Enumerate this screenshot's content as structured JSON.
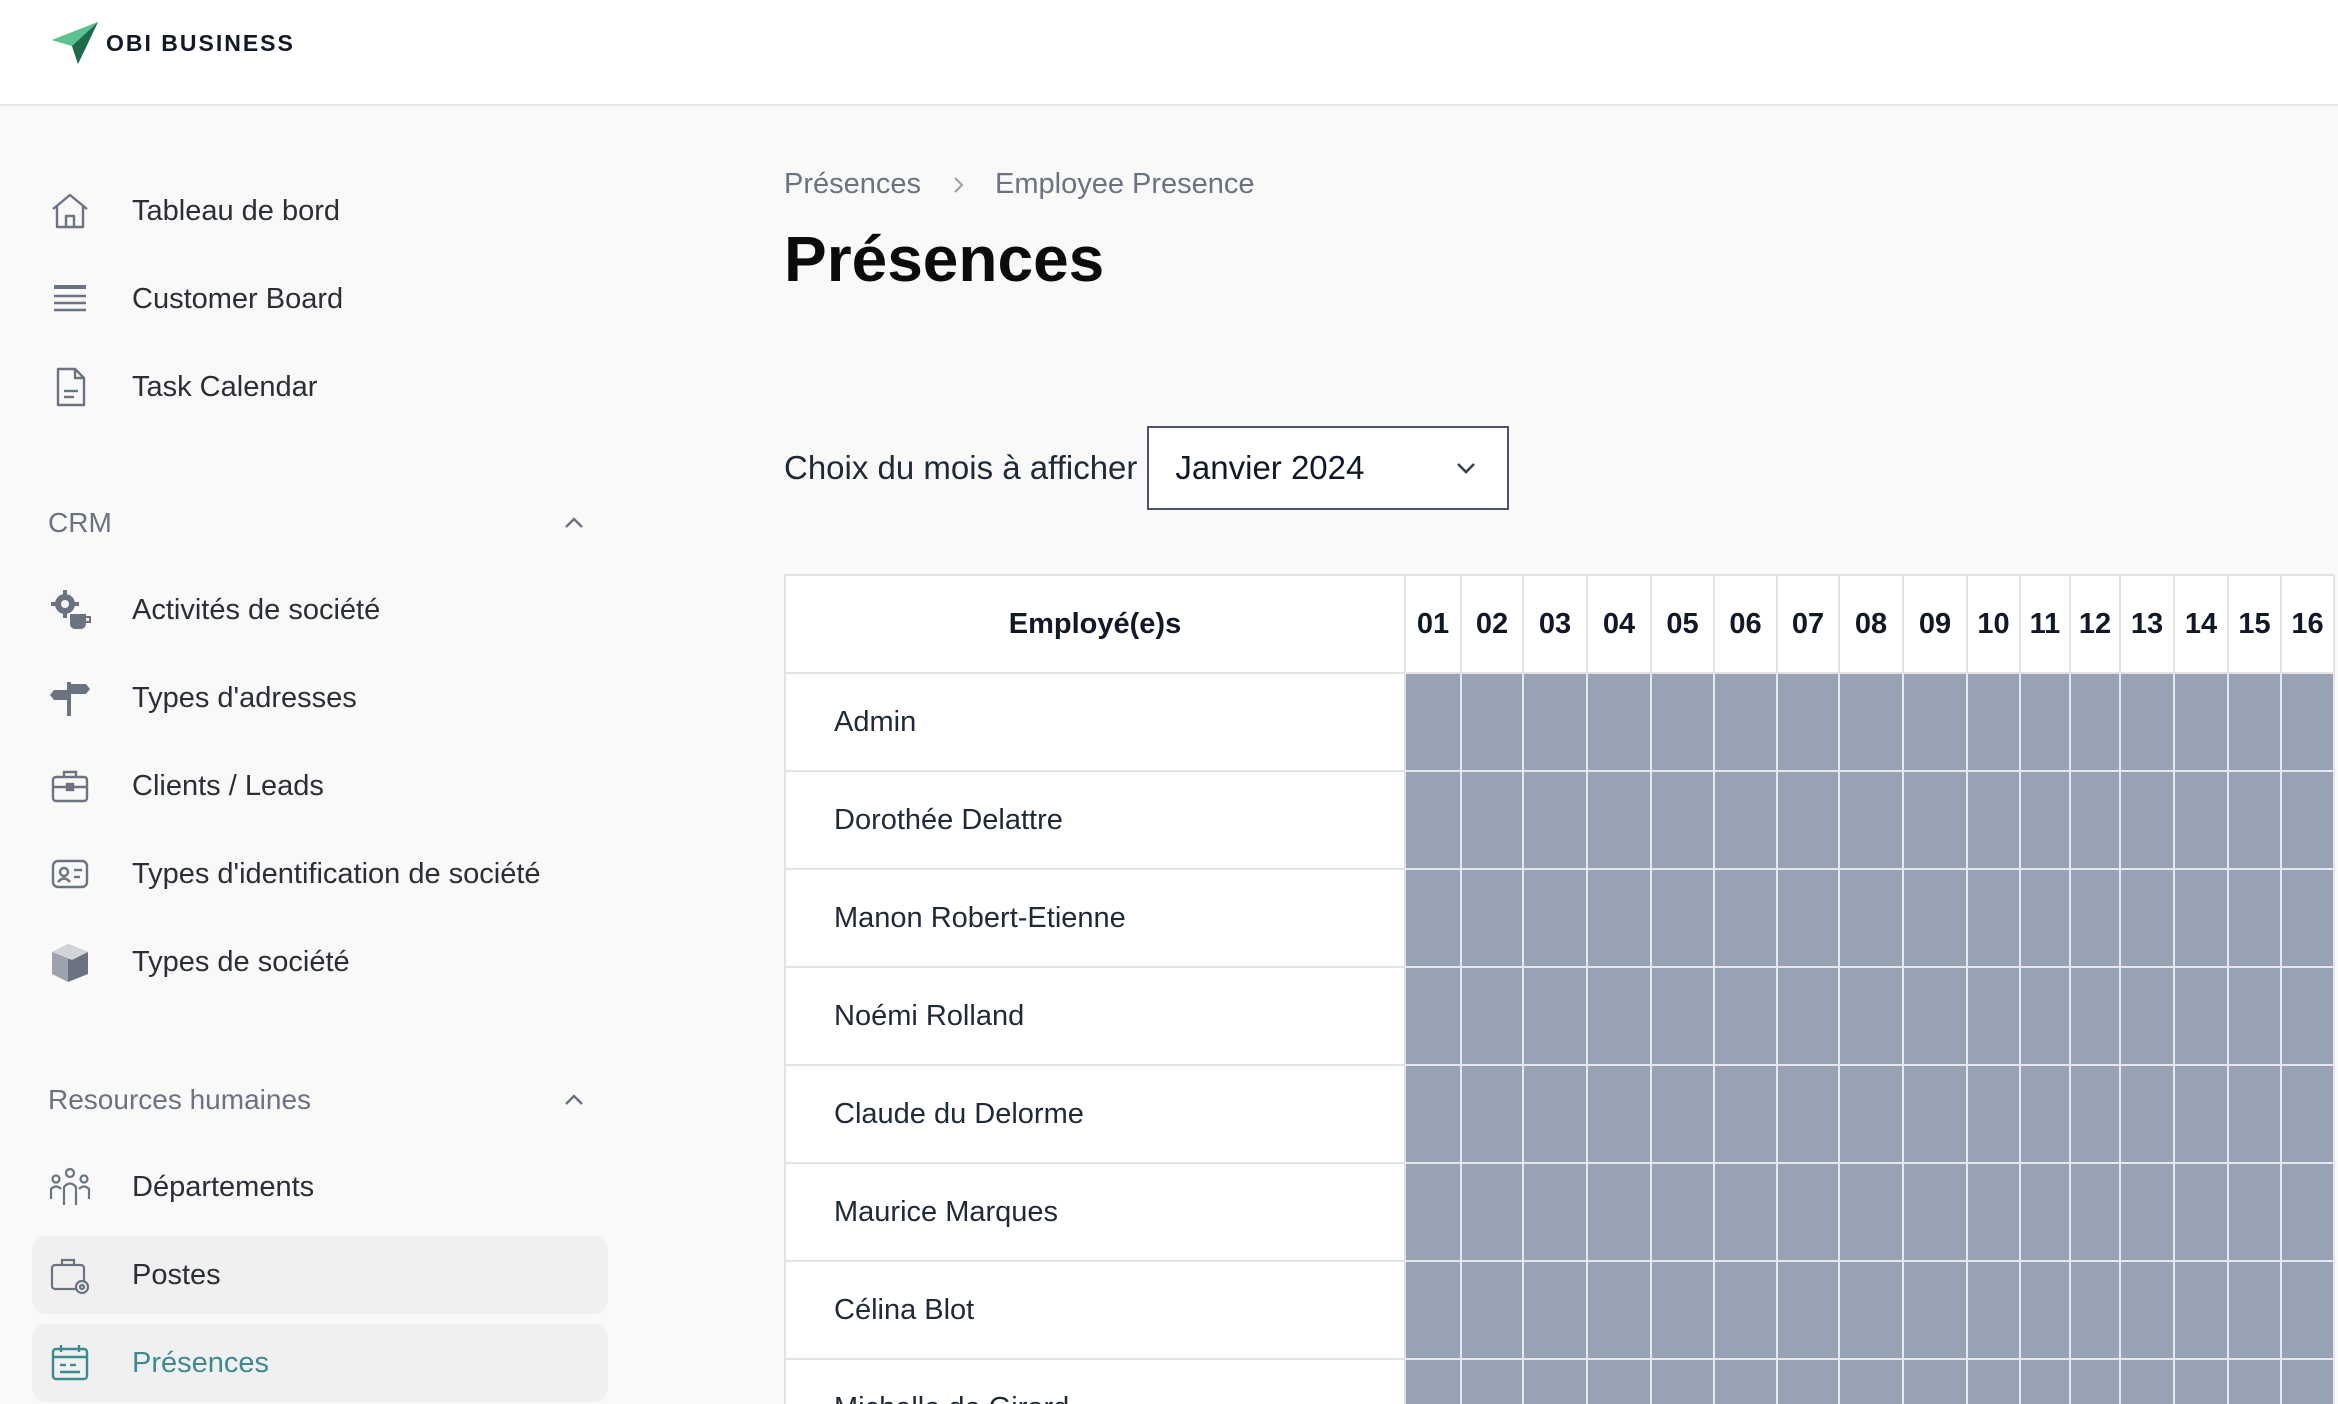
{
  "brand": {
    "name": "OBI BUSINESS"
  },
  "sidebar": {
    "top_items": [
      {
        "label": "Tableau de bord",
        "icon": "home-icon"
      },
      {
        "label": "Customer Board",
        "icon": "list-icon"
      },
      {
        "label": "Task Calendar",
        "icon": "document-icon"
      }
    ],
    "crm": {
      "title": "CRM",
      "items": [
        {
          "label": "Activités de société",
          "icon": "gear-coffee-icon"
        },
        {
          "label": "Types d'adresses",
          "icon": "signpost-icon"
        },
        {
          "label": "Clients / Leads",
          "icon": "briefcase-icon"
        },
        {
          "label": "Types d'identification de société",
          "icon": "id-card-icon"
        },
        {
          "label": "Types de société",
          "icon": "building-icon"
        }
      ]
    },
    "hr": {
      "title": "Resources humaines",
      "items": [
        {
          "label": "Départements",
          "icon": "team-icon"
        },
        {
          "label": "Postes",
          "icon": "briefcase-gear-icon"
        },
        {
          "label": "Présences",
          "icon": "calendar-icon",
          "active": true
        }
      ]
    }
  },
  "breadcrumb": {
    "parent": "Présences",
    "current": "Employee Presence"
  },
  "page": {
    "title": "Présences"
  },
  "month_picker": {
    "label": "Choix du mois à afficher",
    "value": "Janvier 2024"
  },
  "table": {
    "employee_header": "Employé(e)s",
    "days": [
      "01",
      "02",
      "03",
      "04",
      "05",
      "06",
      "07",
      "08",
      "09",
      "10",
      "11",
      "12",
      "13",
      "14",
      "15",
      "16"
    ],
    "employees": [
      "Admin",
      "Dorothée Delattre",
      "Manon Robert-Etienne",
      "Noémi Rolland",
      "Claude du Delorme",
      "Maurice Marques",
      "Célina Blot",
      "Michelle de Girard"
    ]
  },
  "colors": {
    "accent": "#3d8a8f",
    "absent_cell": "#97a2b5",
    "logo_green": "#2f9e6e"
  }
}
